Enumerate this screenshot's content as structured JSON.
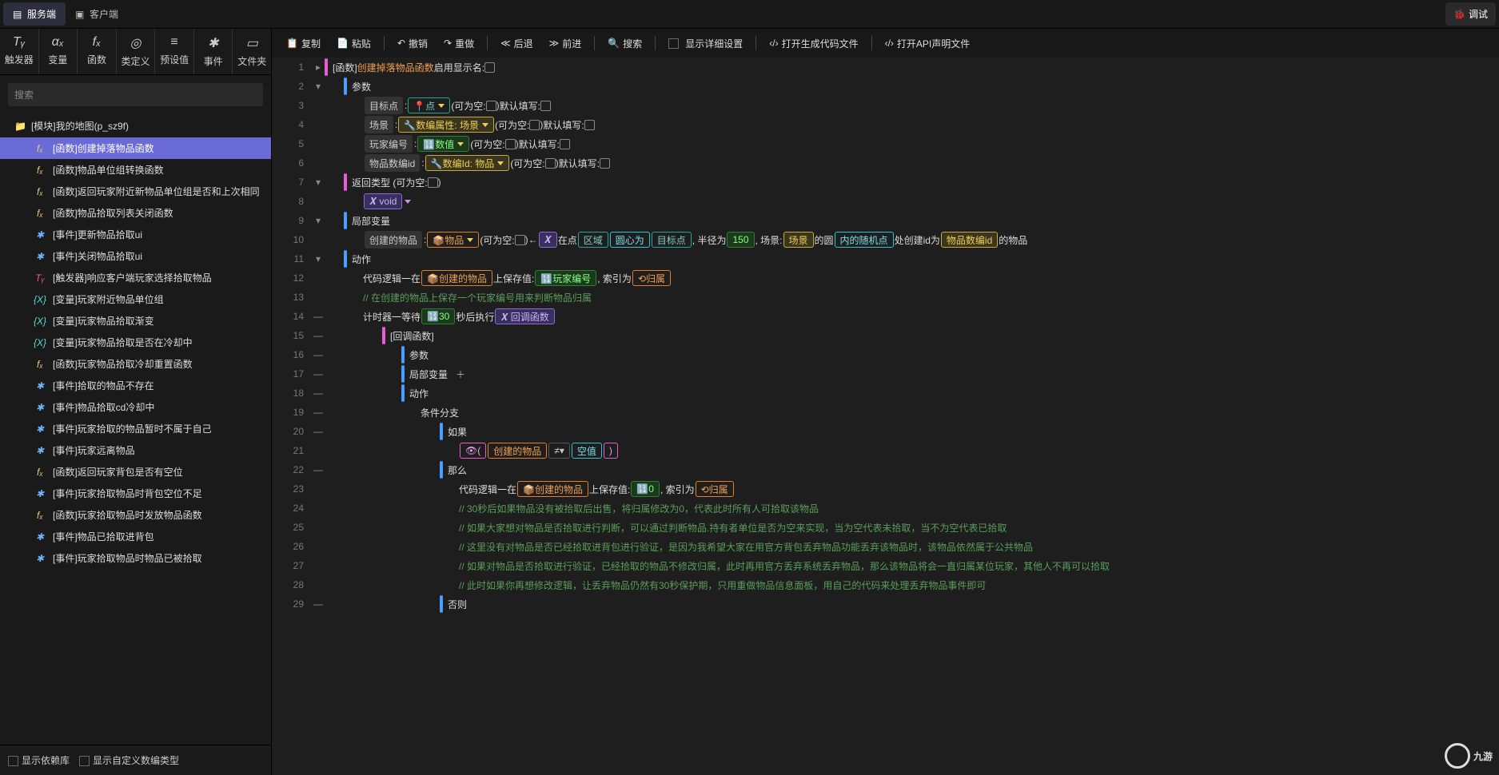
{
  "tabs": {
    "server": "服务端",
    "client": "客户端",
    "debug": "调试"
  },
  "tools": [
    {
      "ico": "Tᵧ",
      "label": "触发器"
    },
    {
      "ico": "αₓ",
      "label": "变量"
    },
    {
      "ico": "fₓ",
      "label": "函数"
    },
    {
      "ico": "◎",
      "label": "类定义"
    },
    {
      "ico": "≡",
      "label": "预设值"
    },
    {
      "ico": "✱",
      "label": "事件"
    },
    {
      "ico": "▭",
      "label": "文件夹"
    }
  ],
  "search_ph": "搜索",
  "tree_root": "[模块]我的地图(p_sz9f)",
  "tree": [
    {
      "ico": "fx",
      "t": "[函数]创建掉落物品函数",
      "sel": true
    },
    {
      "ico": "fx",
      "t": "[函数]物品单位组转换函数"
    },
    {
      "ico": "fx",
      "t": "[函数]返回玩家附近新物品单位组是否和上次相同"
    },
    {
      "ico": "fx",
      "t": "[函数]物品拾取列表关闭函数"
    },
    {
      "ico": "ev",
      "t": "[事件]更新物品拾取ui"
    },
    {
      "ico": "ev",
      "t": "[事件]关闭物品拾取ui"
    },
    {
      "ico": "tr",
      "t": "[触发器]响应客户端玩家选择拾取物品"
    },
    {
      "ico": "var",
      "t": "[变量]玩家附近物品单位组"
    },
    {
      "ico": "var",
      "t": "[变量]玩家物品拾取渐变"
    },
    {
      "ico": "var",
      "t": "[变量]玩家物品拾取是否在冷却中"
    },
    {
      "ico": "fx",
      "t": "[函数]玩家物品拾取冷却重置函数"
    },
    {
      "ico": "ev",
      "t": "[事件]拾取的物品不存在"
    },
    {
      "ico": "ev",
      "t": "[事件]物品拾取cd冷却中"
    },
    {
      "ico": "ev",
      "t": "[事件]玩家拾取的物品暂时不属于自己"
    },
    {
      "ico": "ev",
      "t": "[事件]玩家远离物品"
    },
    {
      "ico": "fx",
      "t": "[函数]返回玩家背包是否有空位"
    },
    {
      "ico": "ev",
      "t": "[事件]玩家拾取物品时背包空位不足"
    },
    {
      "ico": "fx",
      "t": "[函数]玩家拾取物品时发放物品函数"
    },
    {
      "ico": "ev",
      "t": "[事件]物品已拾取进背包"
    },
    {
      "ico": "ev",
      "t": "[事件]玩家拾取物品时物品已被拾取"
    }
  ],
  "footer": {
    "dep": "显示依赖库",
    "custom": "显示自定义数编类型"
  },
  "edbar": {
    "copy": "复制",
    "paste": "粘贴",
    "undo": "撤销",
    "redo": "重做",
    "back": "后退",
    "fwd": "前进",
    "search": "搜索",
    "detail": "显示详细设置",
    "gen": "打开生成代码文件",
    "api": "打开API声明文件"
  },
  "c": {
    "func": "[函数]",
    "create_fn": "创建掉落物品函数",
    "enable": "启用显示名:",
    "params": "参数",
    "target": "目标点",
    "point": "点",
    "empty": "(可为空:",
    "def": "默认填写:",
    "scene": "场景",
    "attr": "数编属性:",
    "scene2": "场景",
    "player": "玩家编号",
    "num": "数值",
    "itemid": "物品数编id",
    "numid": "数编Id:",
    "item": "物品",
    "rettype": "返回类型 (可为空:",
    "void": "void",
    "local": "局部变量",
    "created": "创建的物品",
    "item2": "物品",
    "arrow": "←",
    "xvar": "𝑿",
    "at": "在点",
    "region": "区域",
    "center": "圆心为",
    "target2": "目标点",
    "radius": ", 半径为",
    "r150": "150",
    "scenep": ", 场景:",
    "scene3": "场景",
    "circ": "的圆",
    "inrand": "内的随机点",
    "make": "处创建id为",
    "itemid2": "物品数编id",
    "ofitem": "的物品",
    "action": "动作",
    "logic": "代码逻辑一在",
    "created2": "创建的物品",
    "save": "上保存值:",
    "player2": "玩家编号",
    "idx": ", 索引为",
    "belong": "归属",
    "cmt1": "// 在创建的物品上保存一个玩家编号用来判断物品归属",
    "timer": "计时器一等待",
    "t30": "30",
    "sec": "秒后执行",
    "cb": "回调函数",
    "cbfn": "[回调函数]",
    "params2": "参数",
    "local2": "局部变量",
    "action2": "动作",
    "cond": "条件分支",
    "if": "如果",
    "created3": "创建的物品",
    "ne": "≠▾",
    "null": "空值",
    "then": "那么",
    "logic2": "代码逻辑一在",
    "created4": "创建的物品",
    "save2": "上保存值:",
    "zero": "0",
    "idx2": ", 索引为",
    "belong2": "归属",
    "cmt2": "// 30秒后如果物品没有被拾取后出售，将归属修改为0，代表此时所有人可拾取该物品",
    "cmt3": "// 如果大家想对物品是否拾取进行判断，可以通过判断物品.持有者单位是否为空来实现，当为空代表未拾取，当不为空代表已拾取",
    "cmt4": "// 这里没有对物品是否已经拾取进背包进行验证，是因为我希望大家在用官方背包丢弃物品功能丢弃该物品时，该物品依然属于公共物品",
    "cmt5": "// 如果对物品是否拾取进行验证，已经拾取的物品不修改归属，此时再用官方丢弃系统丢弃物品，那么该物品将会一直归属某位玩家，其他人不再可以拾取",
    "cmt6": "// 此时如果你再想修改逻辑，让丢弃物品仍然有30秒保护期，只用重做物品信息面板，用自己的代码来处理丢弃物品事件即可",
    "else": "否则"
  },
  "watermark": "九游"
}
